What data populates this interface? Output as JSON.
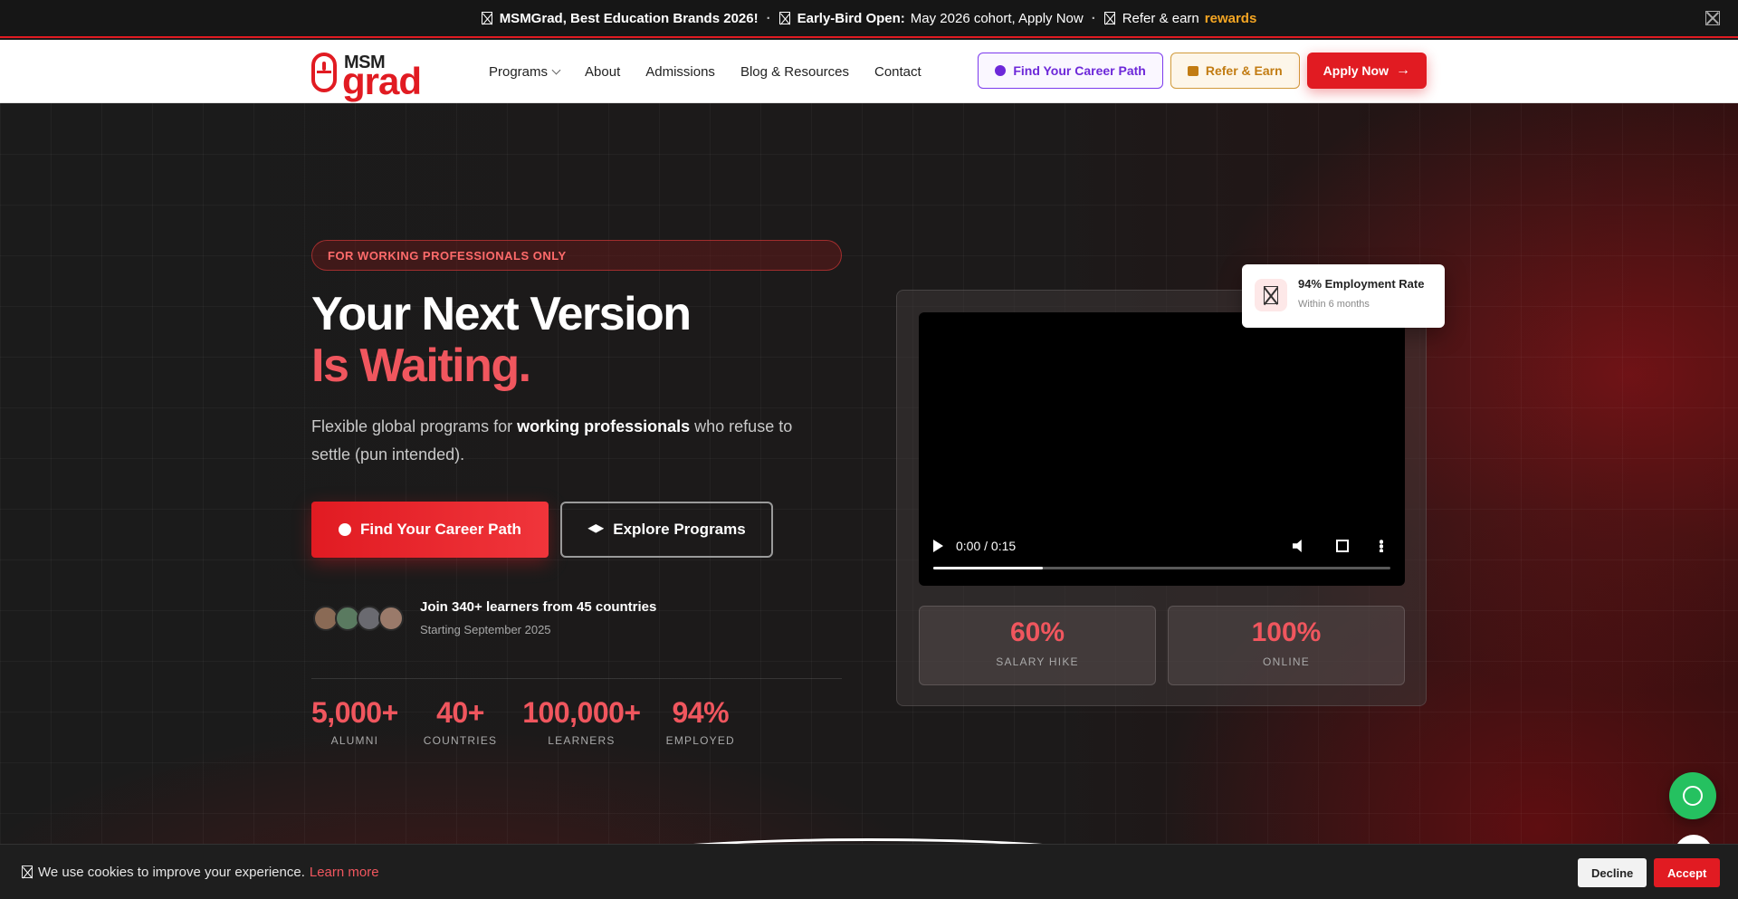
{
  "announcement": {
    "item1": "MSMGrad, Best Education Brands 2026!",
    "item2_bold": "Early-Bird Open:",
    "item2_rest": " May 2026 cohort, Apply Now",
    "item3_text": "Refer & earn ",
    "item3_highlight": "rewards",
    "separator": "·"
  },
  "logo": {
    "line1": "MSM",
    "line2": "grad"
  },
  "nav": {
    "items": [
      "Programs",
      "About",
      "Admissions",
      "Blog & Resources",
      "Contact"
    ]
  },
  "header_buttons": {
    "career": "Find Your Career Path",
    "refer": "Refer & Earn",
    "apply": "Apply Now"
  },
  "hero": {
    "pill": "FOR WORKING PROFESSIONALS ONLY",
    "title_line1": "Your Next Version",
    "title_line2": "Is Waiting.",
    "sub_pre": "Flexible global programs for ",
    "sub_bold": "working professionals",
    "sub_post": " who refuse to settle (pun intended).",
    "cta_primary": "Find Your Career Path",
    "cta_secondary": "Explore Programs",
    "join": "Join 340+ learners from 45 countries",
    "start": "Starting September 2025"
  },
  "stats": [
    {
      "value": "5,000+",
      "label": "ALUMNI"
    },
    {
      "value": "40+",
      "label": "COUNTRIES"
    },
    {
      "value": "100,000+",
      "label": "LEARNERS"
    },
    {
      "value": "94%",
      "label": "EMPLOYED"
    }
  ],
  "video": {
    "time": "0:00 / 0:15",
    "progress": 0.24
  },
  "mini_stats": [
    {
      "value": "60%",
      "label": "SALARY HIKE"
    },
    {
      "value": "100%",
      "label": "ONLINE"
    }
  ],
  "float_card": {
    "title": "94% Employment Rate",
    "subtitle": "Within 6 months"
  },
  "cookie": {
    "text": "We use cookies to improve your experience.",
    "learn_more": "Learn more",
    "decline": "Decline",
    "accept": "Accept"
  },
  "colors": {
    "brand_red": "#e11b22",
    "accent_coral": "#f0565e",
    "rewards_gold": "#f5a623",
    "whatsapp_green": "#25c160"
  }
}
